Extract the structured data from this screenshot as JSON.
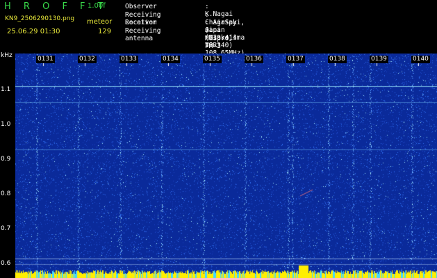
{
  "header": {
    "app_title": "H R O F F T",
    "version": "1.00f",
    "filename": "KN9_2506290130.png",
    "mode": "meteor",
    "timestamp": "25.06.29 01:30",
    "count": "129"
  },
  "info": [
    {
      "label": "Observer",
      "value": ": K.Nagai"
    },
    {
      "label": "Receiving Location",
      "value": ": Chigasaki, Japan (139.414 35.340)"
    },
    {
      "label": "Receiver",
      "value": ": AirSpy mini (Miakejima VOR 108.65MHz)"
    },
    {
      "label": "Receiving antenna",
      "value": ": Maspro FM-3"
    }
  ],
  "yaxis": {
    "unit": "kHz",
    "ticks": [
      "1.1",
      "1.0",
      "0.9",
      "0.8",
      "0.7",
      "0.6"
    ]
  },
  "xaxis": {
    "ticks": [
      "0131",
      "0132",
      "0133",
      "0134",
      "0135",
      "0136",
      "0137",
      "0138",
      "0139",
      "0140"
    ]
  },
  "colors": {
    "background": "#0a2a9a",
    "noise": "#2f6ff0",
    "bright": "#9fe8ff",
    "baseline": "#ffee00",
    "text_green": "#39d94a",
    "text_yellow": "#e8e83a"
  }
}
